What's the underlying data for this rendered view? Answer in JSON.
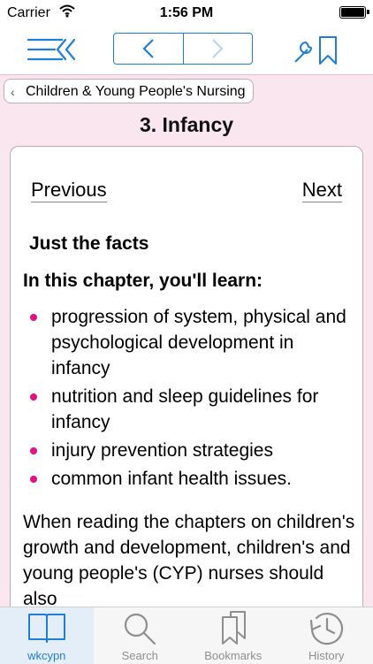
{
  "status_bar": {
    "carrier": "Carrier",
    "time": "1:56 PM"
  },
  "breadcrumb": {
    "label": "Children & Young People's Nursing"
  },
  "chapter": {
    "title": "3. Infancy"
  },
  "pager": {
    "previous": "Previous",
    "next": "Next"
  },
  "content": {
    "section_heading": "Just the facts",
    "intro": "In this chapter, you'll learn:",
    "bullets": [
      "progression of system, physical and psychological development in infancy",
      "nutrition and sleep guidelines for infancy",
      "injury prevention strategies",
      "common infant health issues."
    ],
    "paragraph": "When reading the chapters on children's growth and development, children's and young people's (CYP) nurses should also"
  },
  "tabs": [
    {
      "label": "wkcypn",
      "icon": "book-icon",
      "active": true
    },
    {
      "label": "Search",
      "icon": "magnifier-icon",
      "active": false
    },
    {
      "label": "Bookmarks",
      "icon": "bookmarks-icon",
      "active": false
    },
    {
      "label": "History",
      "icon": "clock-icon",
      "active": false
    }
  ],
  "colors": {
    "accent": "#1f7fd6",
    "bullet": "#e0127f",
    "background": "#f9e6ef"
  }
}
